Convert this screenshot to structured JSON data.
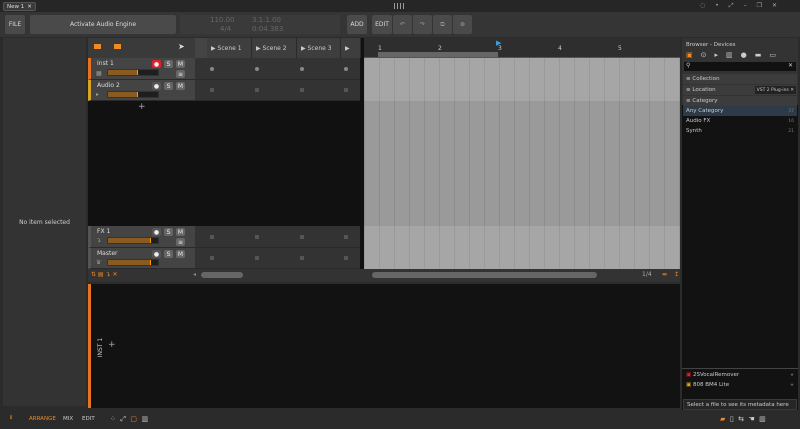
{
  "tabs": [
    {
      "label": "New 1",
      "close": "✕"
    }
  ],
  "toolbar": {
    "file": "FILE",
    "activate": "Activate Audio Engine",
    "tempo": "110.00",
    "signature": "4/4",
    "position": "3.1.1.00",
    "time": "0:04.363",
    "add": "ADD",
    "edit": "EDIT"
  },
  "inspector": {
    "empty": "No item selected"
  },
  "scenes": [
    "Scene 1",
    "Scene 2",
    "Scene 3"
  ],
  "tracks": [
    {
      "name": "Inst 1",
      "color": "#e8731e",
      "level": 0.6
    },
    {
      "name": "Audio 2",
      "color": "#d9a520",
      "level": 0.6
    },
    {
      "name": "FX 1",
      "color": "#666666",
      "level": 0.85
    },
    {
      "name": "Master",
      "color": "#666666",
      "level": 0.85
    }
  ],
  "buttons": {
    "solo": "S",
    "mute": "M"
  },
  "ruler": [
    "1",
    "2",
    "3",
    "4",
    "5"
  ],
  "grid": "1/4",
  "detail": {
    "track": "INST 1"
  },
  "browser": {
    "title": "Browser - Devices",
    "filters": [
      "Collection",
      "Location",
      "Category"
    ],
    "location_tag": "VST 2 Plug-ins",
    "categories": [
      {
        "name": "Any Category",
        "count": "37"
      },
      {
        "name": "Audio FX",
        "count": "16"
      },
      {
        "name": "Synth",
        "count": "21"
      }
    ],
    "results": [
      "2SVocalRemover",
      "808 BM4 Lite"
    ],
    "metadata": "Select a file to see its metadata here"
  },
  "statusbar": {
    "arrange": "ARRANGE",
    "mix": "MIX",
    "edit": "EDIT"
  },
  "colors": {
    "accent": "#f08a24",
    "record": "#e0202a",
    "selected": "#2d3a48"
  }
}
